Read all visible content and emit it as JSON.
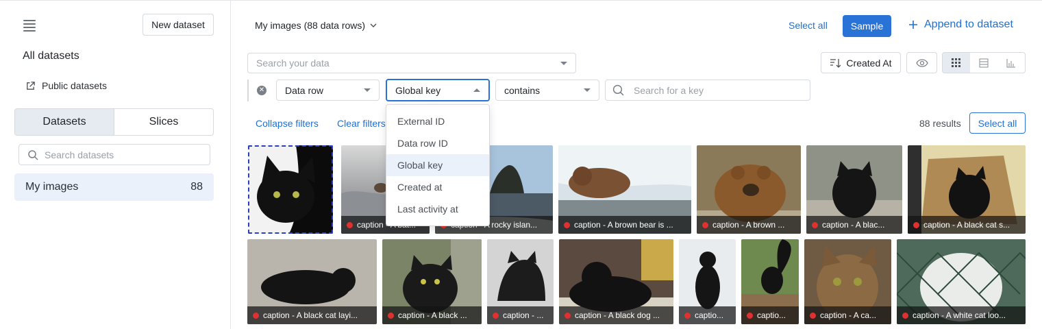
{
  "sidebar": {
    "new_dataset": "New dataset",
    "all_datasets": "All datasets",
    "public_datasets": "Public datasets",
    "tabs": [
      "Datasets",
      "Slices"
    ],
    "search_placeholder": "Search datasets",
    "datasets": [
      {
        "name": "My images",
        "count": "88"
      }
    ]
  },
  "header": {
    "dataset_title": "My images (88 data rows)",
    "select_all": "Select all",
    "sample": "Sample",
    "append": "Append to dataset",
    "search_placeholder": "Search your data",
    "sort_label": "Created At"
  },
  "filter": {
    "field": "Data row",
    "key": "Global key",
    "operator": "contains",
    "key_placeholder": "Search for a key",
    "options": [
      "External ID",
      "Data row ID",
      "Global key",
      "Created at",
      "Last activity at"
    ],
    "selected_option": "Global key"
  },
  "toolbar": {
    "collapse_filters": "Collapse filters",
    "clear_filters": "Clear filters",
    "results": "88 results",
    "select_all": "Select all"
  },
  "grid": {
    "row1": [
      {
        "caption": "",
        "subject": "black cat close-up"
      },
      {
        "caption": "caption - A bat...",
        "subject": "bat"
      },
      {
        "caption": "caption - A rocky islan...",
        "subject": "rocky island"
      },
      {
        "caption": "caption - A brown bear is ...",
        "subject": "bear in waterfall"
      },
      {
        "caption": "caption - A brown ...",
        "subject": "brown bear"
      },
      {
        "caption": "caption - A blac...",
        "subject": "black cat"
      },
      {
        "caption": "caption - A black cat s...",
        "subject": "black cat in box"
      }
    ],
    "row2": [
      {
        "caption": "caption - A black cat layi...",
        "subject": "black cat lying"
      },
      {
        "caption": "caption - A black ...",
        "subject": "black cat"
      },
      {
        "caption": "caption - ...",
        "subject": "black cat arched"
      },
      {
        "caption": "caption - A black dog ...",
        "subject": "black dog"
      },
      {
        "caption": "captio...",
        "subject": "black dog in snow"
      },
      {
        "caption": "captio...",
        "subject": "black squirrel"
      },
      {
        "caption": "caption - A ca...",
        "subject": "tabby cat"
      },
      {
        "caption": "caption - A white cat loo...",
        "subject": "white cat behind fence"
      }
    ]
  },
  "colors": {
    "accent": "#2a73d6",
    "status_dot": "#e03131"
  }
}
